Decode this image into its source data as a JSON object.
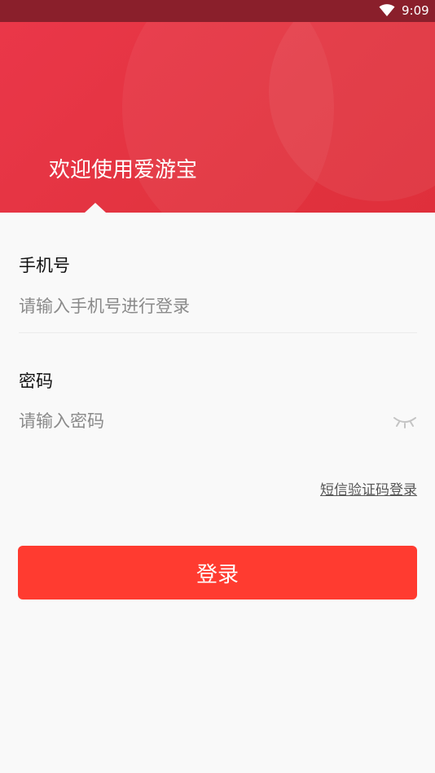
{
  "status_bar": {
    "time": "9:09",
    "wifi_icon": "wifi-icon"
  },
  "header": {
    "title": "欢迎使用爱游宝"
  },
  "form": {
    "phone": {
      "label": "手机号",
      "placeholder": "请输入手机号进行登录",
      "value": ""
    },
    "password": {
      "label": "密码",
      "placeholder": "请输入密码",
      "value": "",
      "toggle_icon": "eye-closed-icon"
    },
    "sms_login_link": "短信验证码登录",
    "login_button": "登录"
  },
  "colors": {
    "status_bar": "#8a1f2b",
    "header": "#e2333f",
    "accent": "#ff3b30",
    "background": "#f9f9f9"
  }
}
